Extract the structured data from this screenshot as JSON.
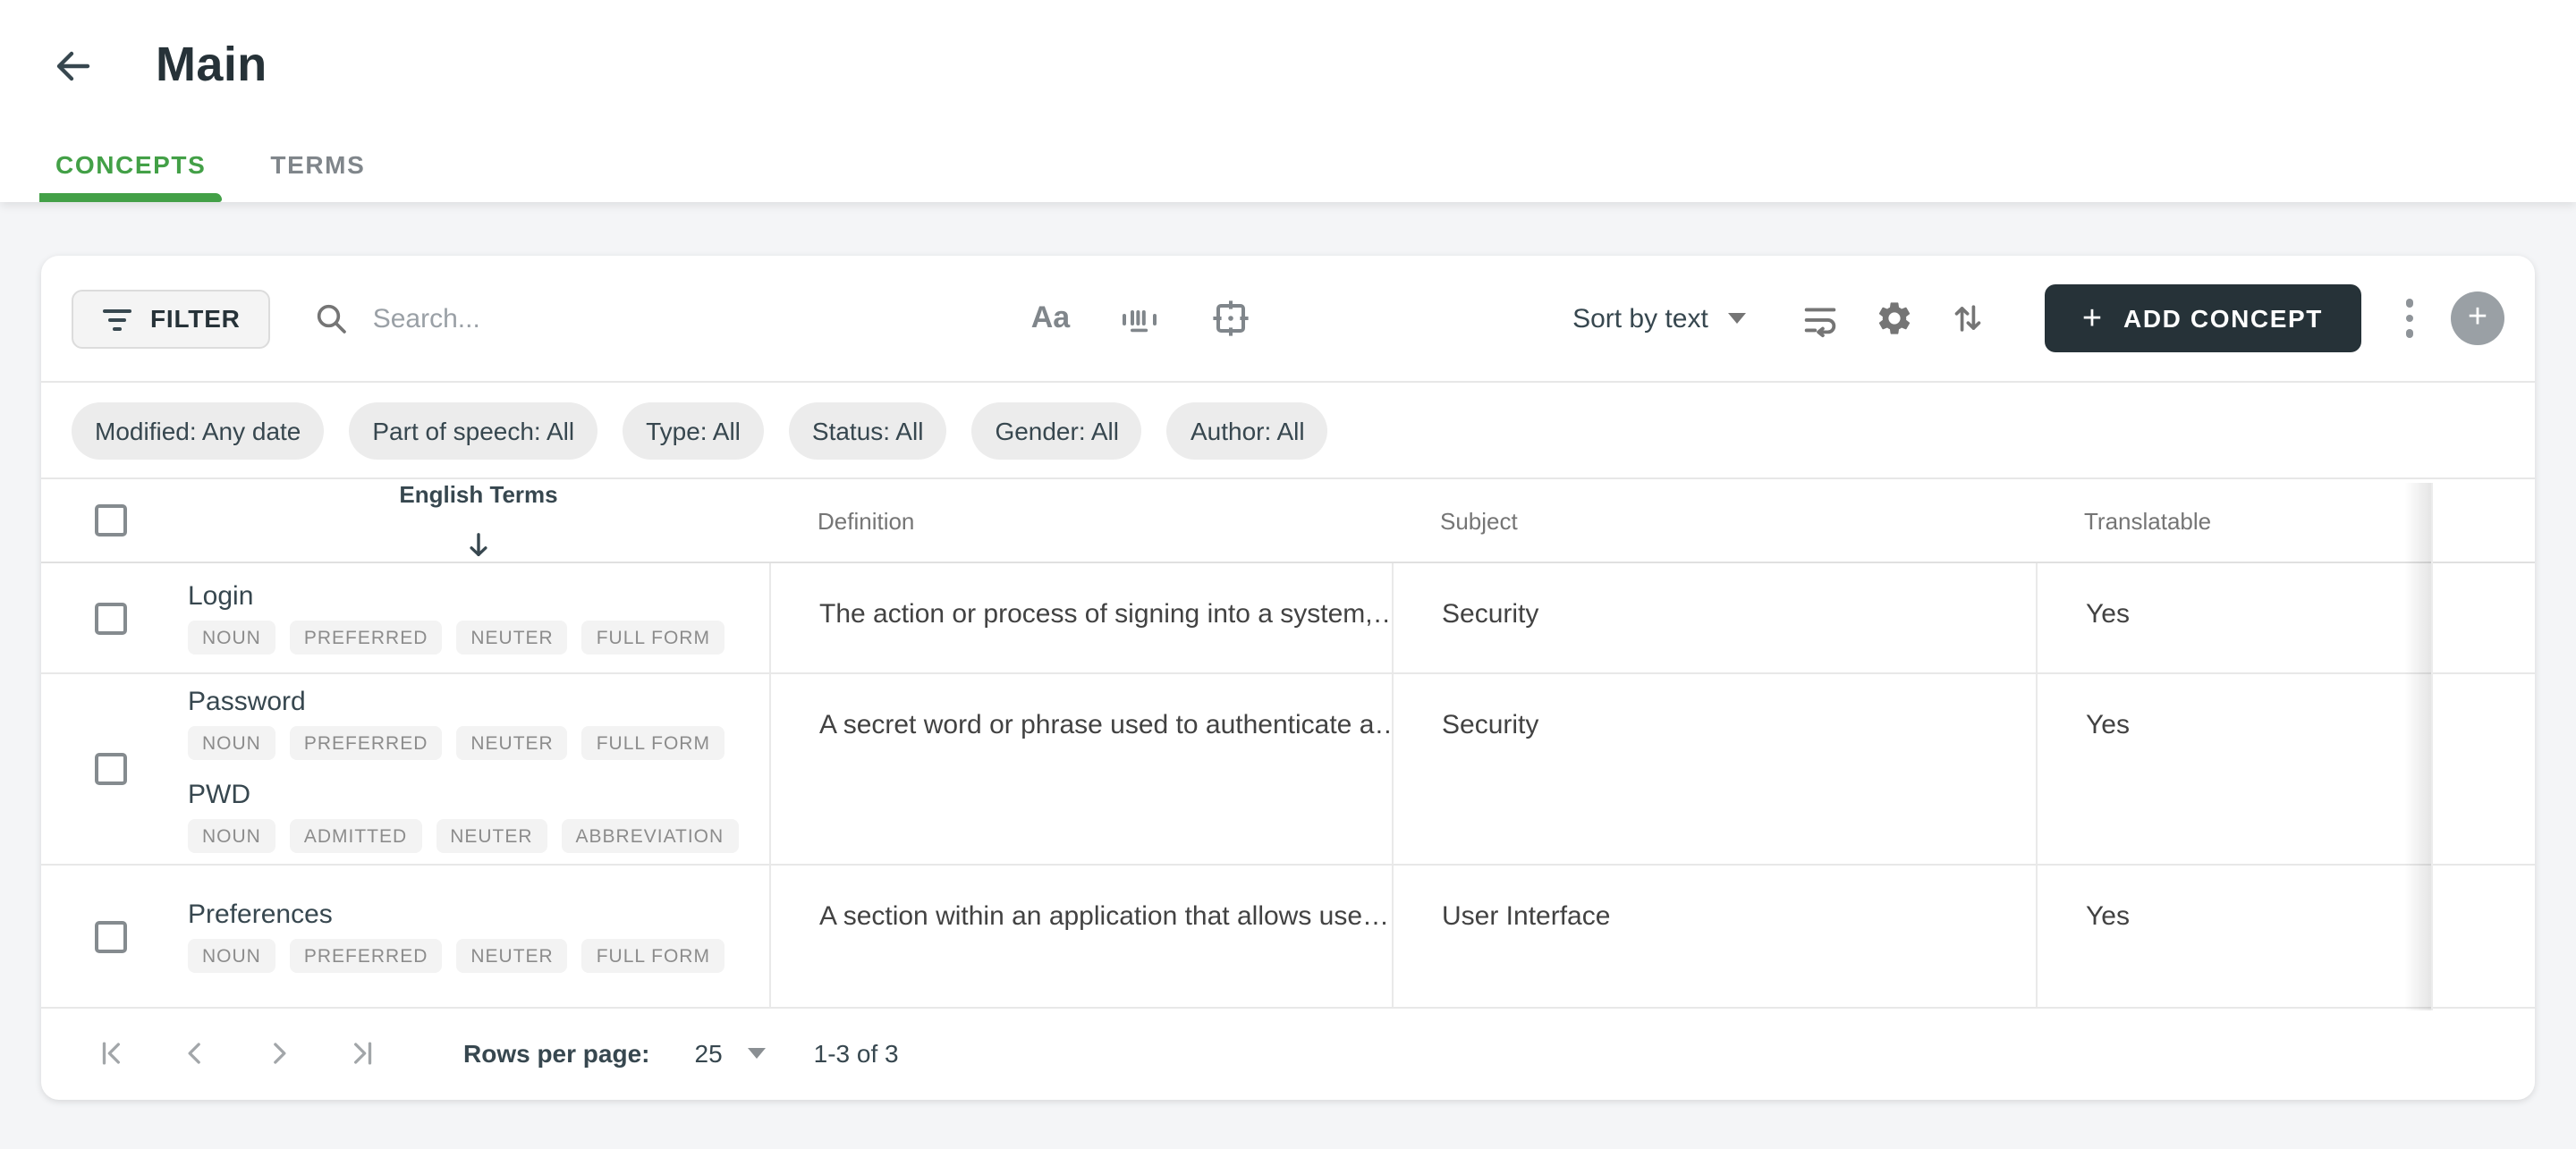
{
  "header": {
    "title": "Main",
    "back_icon": "arrow-left"
  },
  "tabs": [
    {
      "label": "CONCEPTS",
      "active": true
    },
    {
      "label": "TERMS",
      "active": false
    }
  ],
  "toolbar": {
    "filter_label": "FILTER",
    "search_placeholder": "Search...",
    "match_case_glyph": "Aa",
    "sort_label": "Sort by text",
    "add_concept_label": "ADD CONCEPT",
    "add_concept_plus": "+",
    "plus_circle_glyph": "+",
    "icons": [
      "filter-lines",
      "magnifier",
      "match-case",
      "barcode",
      "center-target",
      "wrap-text",
      "gear",
      "sort-arrows",
      "kebab-menu",
      "add-circle"
    ]
  },
  "filters": [
    {
      "label": "Modified: Any date"
    },
    {
      "label": "Part of speech: All"
    },
    {
      "label": "Type: All"
    },
    {
      "label": "Status: All"
    },
    {
      "label": "Gender: All"
    },
    {
      "label": "Author: All"
    }
  ],
  "table": {
    "columns": {
      "terms": "English Terms",
      "definition": "Definition",
      "subject": "Subject",
      "translatable": "Translatable"
    },
    "sort": {
      "column": "English Terms",
      "direction": "down"
    },
    "rows": [
      {
        "terms": [
          {
            "text": "Login",
            "badges": [
              "NOUN",
              "PREFERRED",
              "NEUTER",
              "FULL FORM"
            ]
          }
        ],
        "definition": "The action or process of signing into a system,…",
        "subject": "Security",
        "translatable": "Yes"
      },
      {
        "terms": [
          {
            "text": "Password",
            "badges": [
              "NOUN",
              "PREFERRED",
              "NEUTER",
              "FULL FORM"
            ]
          },
          {
            "text": "PWD",
            "badges": [
              "NOUN",
              "ADMITTED",
              "NEUTER",
              "ABBREVIATION"
            ]
          }
        ],
        "definition": "A secret word or phrase used to authenticate a…",
        "subject": "Security",
        "translatable": "Yes"
      },
      {
        "terms": [
          {
            "text": "Preferences",
            "badges": [
              "NOUN",
              "PREFERRED",
              "NEUTER",
              "FULL FORM"
            ]
          }
        ],
        "definition": "A section within an application that allows use…",
        "subject": "User Interface",
        "translatable": "Yes"
      }
    ]
  },
  "pagination": {
    "rows_per_page_label": "Rows per page:",
    "rows_per_page": "25",
    "range": "1-3 of 3"
  },
  "colors": {
    "accent_green": "#43a047",
    "primary_button": "#263238",
    "page_bg": "#f4f5f7"
  }
}
